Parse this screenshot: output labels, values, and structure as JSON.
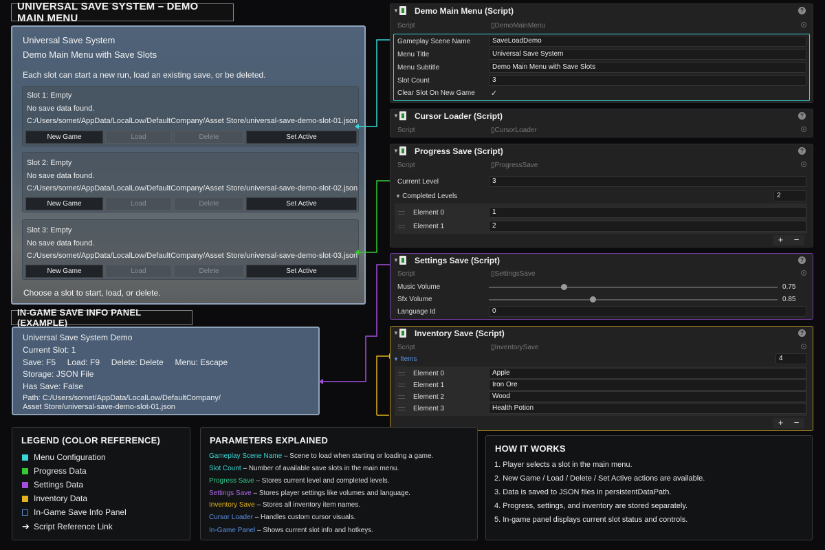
{
  "main_title": "UNIVERSAL SAVE SYSTEM – DEMO MAIN MENU",
  "menu_panel": {
    "title": "Universal Save System",
    "subtitle": "Demo Main Menu with Save Slots",
    "description": "Each slot can start a new run, load an existing save, or be deleted.",
    "footer": "Choose a slot to start, load, or delete.",
    "slots": [
      {
        "title": "Slot 1: Empty",
        "status": "No save data found.",
        "path": "C:/Users/somet/AppData/LocalLow/DefaultCompany/Asset Store/universal-save-demo-slot-01.json"
      },
      {
        "title": "Slot 2: Empty",
        "status": "No save data found.",
        "path": "C:/Users/somet/AppData/LocalLow/DefaultCompany/Asset Store/universal-save-demo-slot-02.json"
      },
      {
        "title": "Slot 3: Empty",
        "status": "No save data found.",
        "path": "C:/Users/somet/AppData/LocalLow/DefaultCompany/Asset Store/universal-save-demo-slot-03.json"
      }
    ],
    "buttons": {
      "new_game": "New Game",
      "load": "Load",
      "delete": "Delete",
      "set_active": "Set Active"
    }
  },
  "info_title": "IN-GAME SAVE INFO PANEL (EXAMPLE)",
  "info_panel": {
    "line1": "Universal Save System Demo",
    "line2": "Current Slot: 1",
    "line3": "Save: F5     Load: F9     Delete: Delete     Menu: Escape",
    "line4": "Storage: JSON File",
    "line5": "Has Save: False",
    "line6": "Path: C:/Users/somet/AppData/LocalLow/DefaultCompany/",
    "line7": "Asset Store/universal-save-demo-slot-01.json"
  },
  "inspector": {
    "script_label": "Script",
    "demo_menu": {
      "title": "Demo Main Menu (Script)",
      "script": "DemoMainMenu",
      "fields": [
        {
          "label": "Gameplay Scene Name",
          "value": "SaveLoadDemo"
        },
        {
          "label": "Menu Title",
          "value": "Universal Save System"
        },
        {
          "label": "Menu Subtitle",
          "value": "Demo Main Menu with Save Slots"
        },
        {
          "label": "Slot Count",
          "value": "3"
        },
        {
          "label": "Clear Slot On New Game",
          "value": "✓"
        }
      ]
    },
    "cursor_loader": {
      "title": "Cursor Loader (Script)",
      "script": "CursorLoader"
    },
    "progress_save": {
      "title": "Progress Save (Script)",
      "script": "ProgressSave",
      "current_level_label": "Current Level",
      "current_level": "3",
      "completed_label": "Completed Levels",
      "completed_count": "2",
      "elements": [
        {
          "label": "Element 0",
          "value": "1"
        },
        {
          "label": "Element 1",
          "value": "2"
        }
      ]
    },
    "settings_save": {
      "title": "Settings Save (Script)",
      "script": "SettingsSave",
      "music_label": "Music Volume",
      "music_value": "0.75",
      "music_level": 0.75,
      "sfx_label": "Sfx Volume",
      "sfx_value": "0.85",
      "sfx_level": 0.85,
      "language_label": "Language Id",
      "language_value": "0"
    },
    "inventory_save": {
      "title": "Inventory Save (Script)",
      "script": "InventorySave",
      "items_label": "Items",
      "items_count": "4",
      "elements": [
        {
          "label": "Element 0",
          "value": "Apple"
        },
        {
          "label": "Element 1",
          "value": "Iron Ore"
        },
        {
          "label": "Element 2",
          "value": "Wood"
        },
        {
          "label": "Element 3",
          "value": "Health Potion"
        }
      ]
    },
    "plus": "+",
    "minus": "−",
    "help": "?"
  },
  "legend": {
    "title": "LEGEND (COLOR REFERENCE)",
    "items": [
      {
        "label": "Menu Configuration",
        "color": "#3ad6d6"
      },
      {
        "label": "Progress Data",
        "color": "#35c935"
      },
      {
        "label": "Settings Data",
        "color": "#a24fe0"
      },
      {
        "label": "Inventory Data",
        "color": "#e3b21c"
      },
      {
        "label": "In-Game Save Info Panel",
        "color": "#5a8fe0"
      },
      {
        "label": "Script Reference Link",
        "color": "#ffffff"
      }
    ]
  },
  "params": {
    "title": "PARAMETERS EXPLAINED",
    "items": [
      {
        "name": "Gameplay Scene Name",
        "desc": " – Scene to load when starting or loading a game.",
        "color": "#3ad6d6"
      },
      {
        "name": "Slot Count",
        "desc": " – Number of available save slots in the main menu.",
        "color": "#3ad6d6"
      },
      {
        "name": "Progress Save",
        "desc": " – Stores current level and completed levels.",
        "color": "#35c98a"
      },
      {
        "name": "Settings Save",
        "desc": " – Stores player settings like volumes and language.",
        "color": "#b06ae8"
      },
      {
        "name": "Inventory Save",
        "desc": " – Stores all inventory item names.",
        "color": "#e3b21c"
      },
      {
        "name": "Cursor Loader",
        "desc": " – Handles custom cursor visuals.",
        "color": "#5a8fe0"
      },
      {
        "name": "In-Game Panel",
        "desc": " – Shows current slot info and hotkeys.",
        "color": "#5a8fe0"
      }
    ]
  },
  "how": {
    "title": "HOW IT WORKS",
    "items": [
      "1.  Player selects a slot in the main menu.",
      "2.  New Game / Load / Delete / Set Active actions are available.",
      "3.  Data is saved to JSON files in persistentDataPath.",
      "4.  Progress, settings, and inventory are stored separately.",
      "5.  In-game panel displays current slot status and controls."
    ]
  },
  "colors": {
    "cyan": "#3ad6d6",
    "green": "#35c935",
    "purple": "#a24fe0",
    "gold": "#e3b21c",
    "blue": "#5a8fe0"
  }
}
